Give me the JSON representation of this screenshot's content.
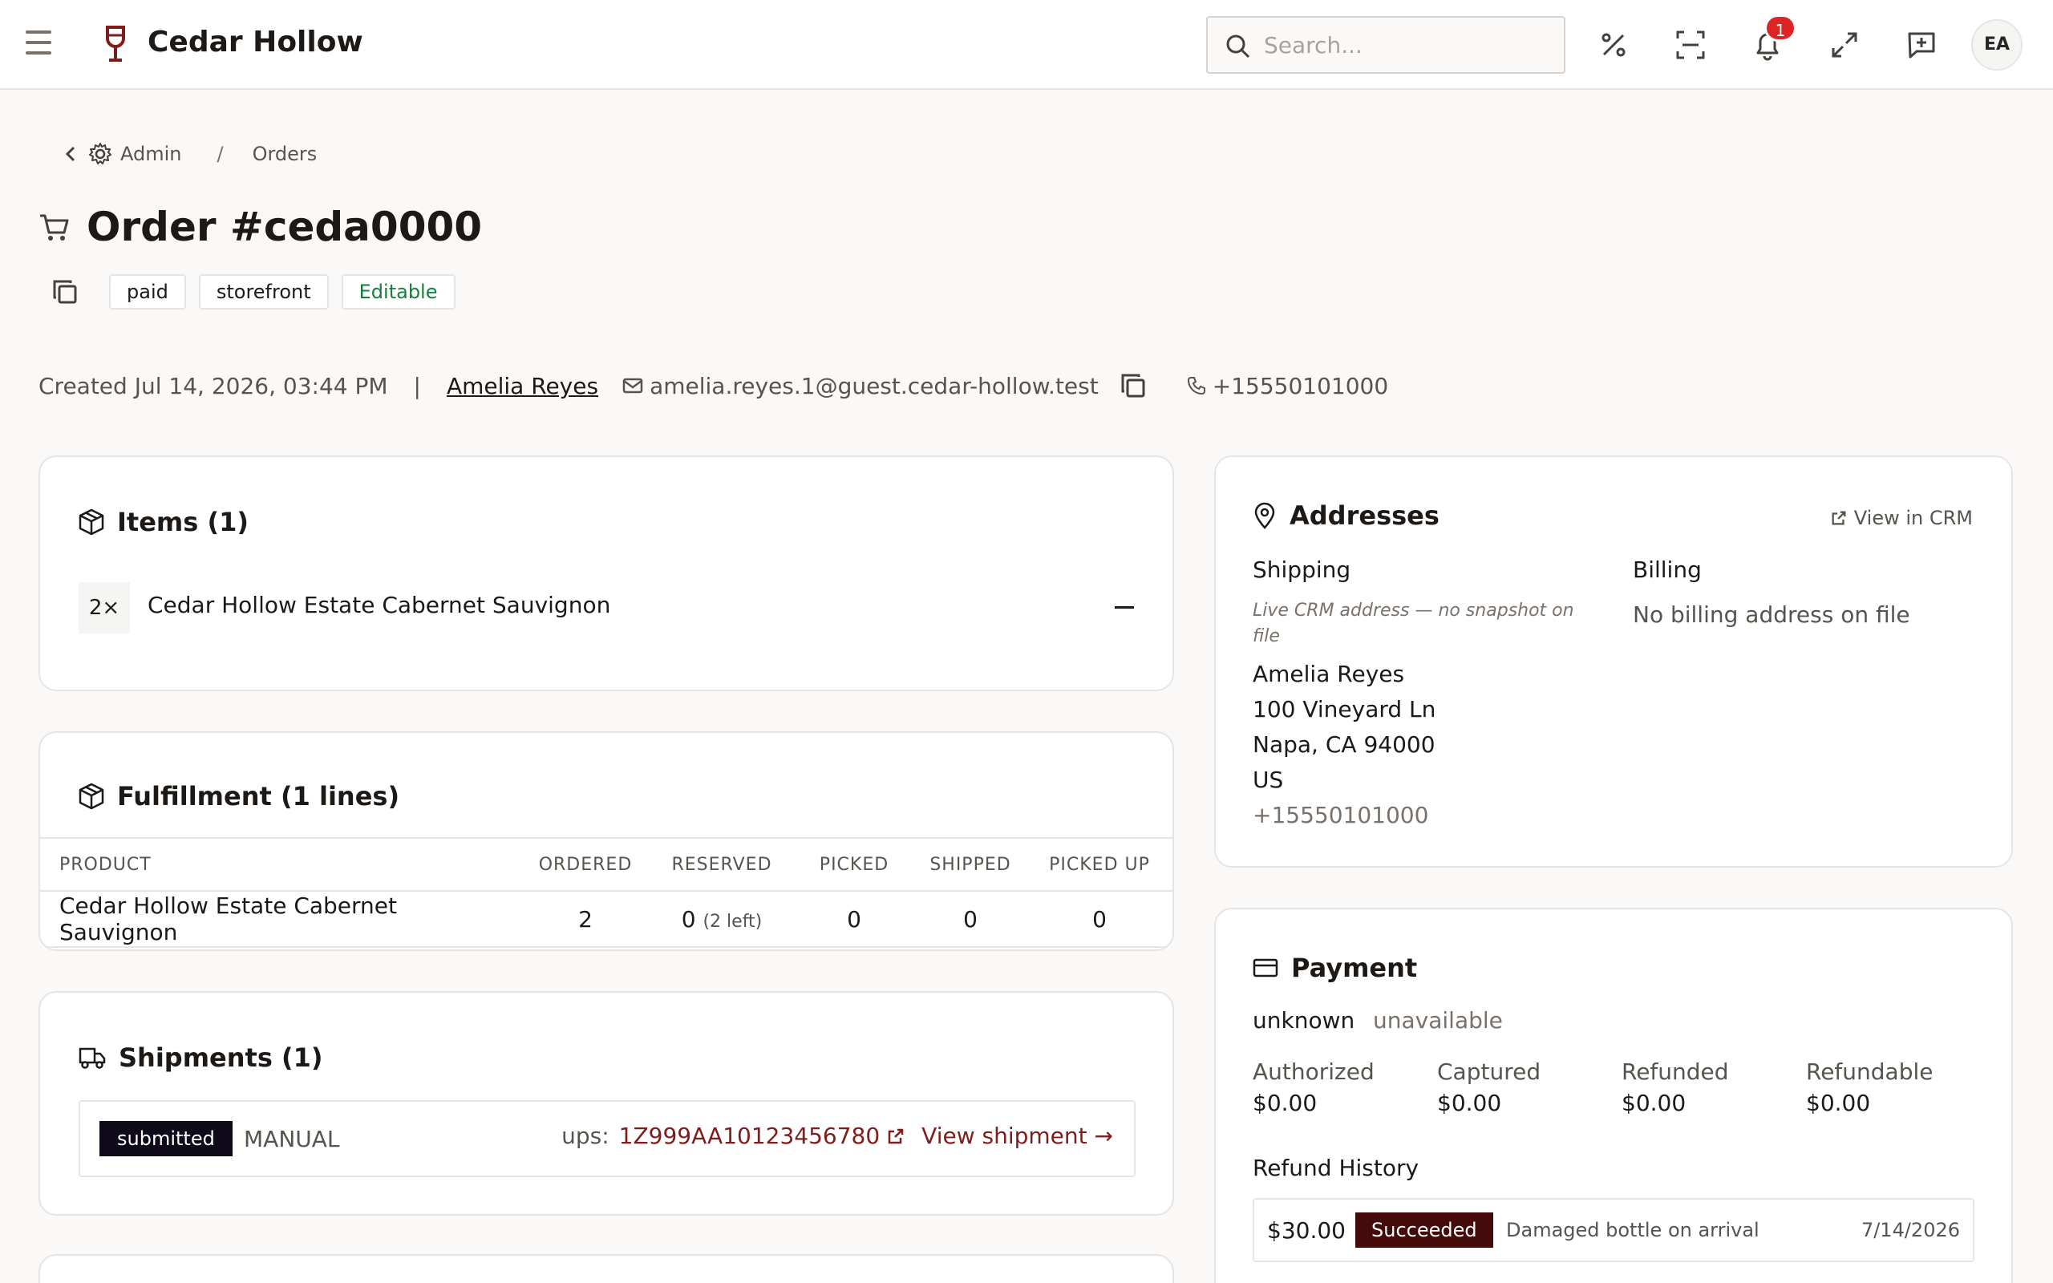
{
  "header": {
    "brand": "Cedar Hollow",
    "search_placeholder": "Search...",
    "notification_count": "1",
    "avatar_initials": "EA"
  },
  "breadcrumb": {
    "parent": "Admin",
    "separator": "/",
    "current": "Orders"
  },
  "order": {
    "title": "Order #ceda0000",
    "badges": [
      "paid",
      "storefront",
      "Editable"
    ],
    "created": "Created Jul 14, 2026, 03:44 PM",
    "separator": "|",
    "customer_name": "Amelia Reyes",
    "customer_email": "amelia.reyes.1@guest.cedar-hollow.test",
    "customer_phone": "+15550101000"
  },
  "items": {
    "title": "Items (1)",
    "list": [
      {
        "qty": "2×",
        "name": "Cedar Hollow Estate Cabernet Sauvignon"
      }
    ]
  },
  "fulfillment": {
    "title": "Fulfillment (1 lines)",
    "columns": [
      "PRODUCT",
      "ORDERED",
      "RESERVED",
      "PICKED",
      "SHIPPED",
      "PICKED UP"
    ],
    "rows": [
      {
        "product": "Cedar Hollow Estate Cabernet Sauvignon",
        "ordered": "2",
        "reserved": "0",
        "reserved_note": "(2 left)",
        "picked": "0",
        "shipped": "0",
        "picked_up": "0"
      }
    ]
  },
  "shipments": {
    "title": "Shipments (1)",
    "list": [
      {
        "status": "submitted",
        "method": "MANUAL",
        "carrier": "ups:",
        "tracking": "1Z999AA10123456780",
        "view_label": "View shipment →"
      }
    ]
  },
  "addresses": {
    "title": "Addresses",
    "view_crm": "View in CRM",
    "shipping": {
      "title": "Shipping",
      "note": "Live CRM address — no snapshot on file",
      "name": "Amelia Reyes",
      "street": "100 Vineyard Ln",
      "city": "Napa, CA 94000",
      "country": "US",
      "phone": "+15550101000"
    },
    "billing": {
      "title": "Billing",
      "empty": "No billing address on file"
    }
  },
  "payment": {
    "title": "Payment",
    "method": "unknown",
    "state": "unavailable",
    "metrics": [
      {
        "label": "Authorized",
        "value": "$0.00"
      },
      {
        "label": "Captured",
        "value": "$0.00"
      },
      {
        "label": "Refunded",
        "value": "$0.00"
      },
      {
        "label": "Refundable",
        "value": "$0.00"
      }
    ],
    "refund_history_title": "Refund History",
    "refunds": [
      {
        "amount": "$30.00",
        "status": "Succeeded",
        "reason": "Damaged bottle on arrival",
        "date": "7/14/2026"
      }
    ]
  },
  "colors": {
    "brand": "#7f1d1d",
    "notification": "#dc2626",
    "editable": "#15803d",
    "submitted_pill": "#0f0a1a",
    "succeeded_pill": "#450a0a"
  }
}
